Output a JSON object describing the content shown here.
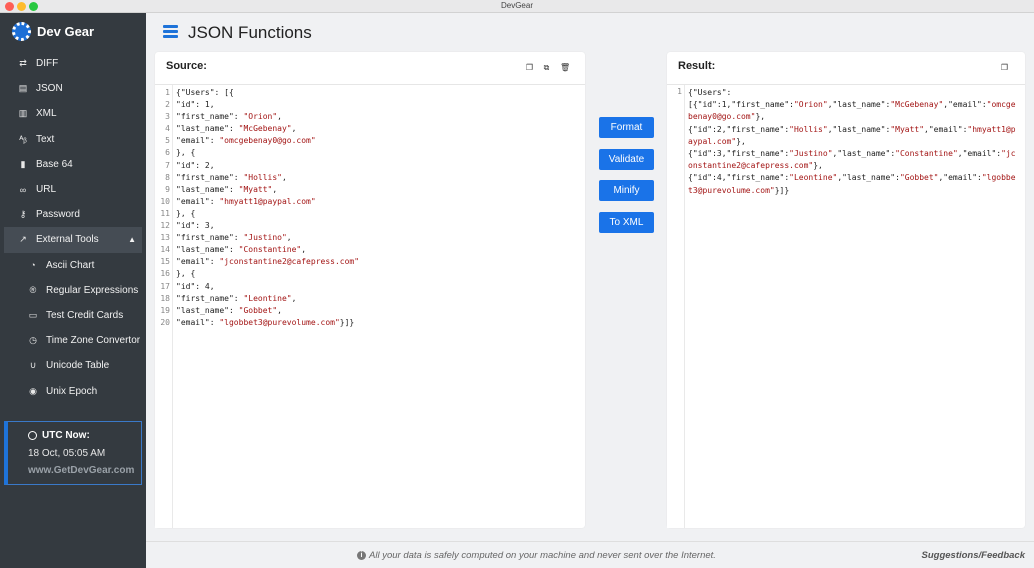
{
  "window": {
    "title": "DevGear"
  },
  "brand": {
    "name": "Dev Gear",
    "icon": "gear-icon"
  },
  "sidebar": {
    "items": [
      {
        "label": "DIFF",
        "icon": "diff-icon"
      },
      {
        "label": "JSON",
        "icon": "json-icon"
      },
      {
        "label": "XML",
        "icon": "xml-icon"
      },
      {
        "label": "Text",
        "icon": "text-icon"
      },
      {
        "label": "Base 64",
        "icon": "file-icon"
      },
      {
        "label": "URL",
        "icon": "link-icon"
      },
      {
        "label": "Password",
        "icon": "key-icon"
      },
      {
        "label": "External Tools",
        "icon": "external-link-icon"
      },
      {
        "label": "Ascii Chart",
        "icon": "clock-icon"
      },
      {
        "label": "Regular Expressions",
        "icon": "registered-icon"
      },
      {
        "label": "Test Credit Cards",
        "icon": "credit-card-icon"
      },
      {
        "label": "Time Zone Convertor",
        "icon": "clock-icon"
      },
      {
        "label": "Unicode Table",
        "icon": "magnet-icon"
      },
      {
        "label": "Unix Epoch",
        "icon": "stopwatch-icon"
      }
    ]
  },
  "utc": {
    "title": "UTC Now:",
    "time": "18 Oct, 05:05 AM",
    "site": "www.GetDevGear.com"
  },
  "header": {
    "title": "JSON Functions"
  },
  "source": {
    "label": "Source:",
    "tools": [
      "copy-icon",
      "paste-icon",
      "trash-icon"
    ]
  },
  "result": {
    "label": "Result:",
    "tools": [
      "copy-icon"
    ],
    "line_number": "1"
  },
  "actions": {
    "format": "Format",
    "validate": "Validate",
    "minify": "Minify",
    "to_xml": "To XML"
  },
  "footer": {
    "note": "All your data is safely computed on your machine and never sent over the Internet.",
    "feedback": "Suggestions/Feedback"
  },
  "colors": {
    "accent": "#1a73e8",
    "sidebar": "#343a40",
    "string": "#a31515"
  }
}
